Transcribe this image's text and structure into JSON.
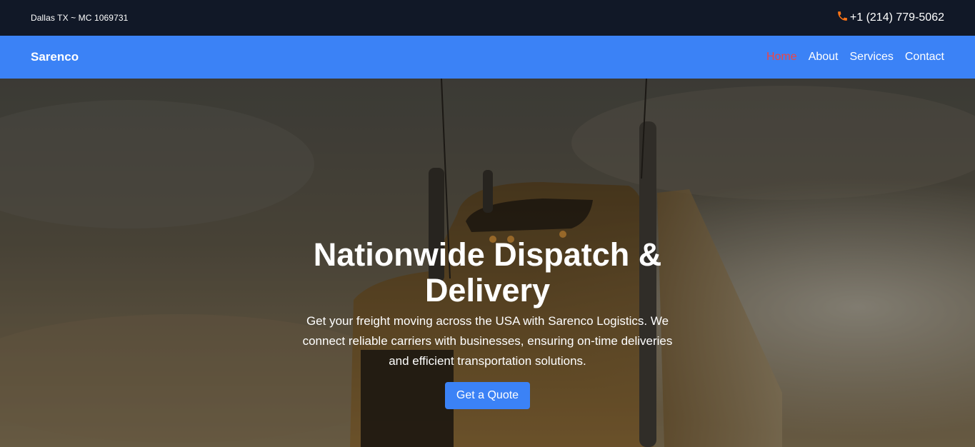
{
  "topbar": {
    "location": "Dallas TX ~ MC 1069731",
    "phone": "+1 (214) 779-5062",
    "phone_icon": "phone-icon"
  },
  "navbar": {
    "brand": "Sarenco",
    "links": [
      {
        "label": "Home",
        "active": true
      },
      {
        "label": "About",
        "active": false
      },
      {
        "label": "Services",
        "active": false
      },
      {
        "label": "Contact",
        "active": false
      }
    ]
  },
  "hero": {
    "title": "Nationwide Dispatch & Delivery",
    "description": "Get your freight moving across the USA with Sarenco Logistics. We connect reliable carriers with businesses, ensuring on-time deliveries and efficient transportation solutions.",
    "cta_label": "Get a Quote",
    "background": "truck-photo"
  },
  "colors": {
    "topbar_bg": "#111827",
    "navbar_bg": "#3b82f6",
    "active_link": "#ef4444",
    "cta_bg": "#3b82f6"
  }
}
